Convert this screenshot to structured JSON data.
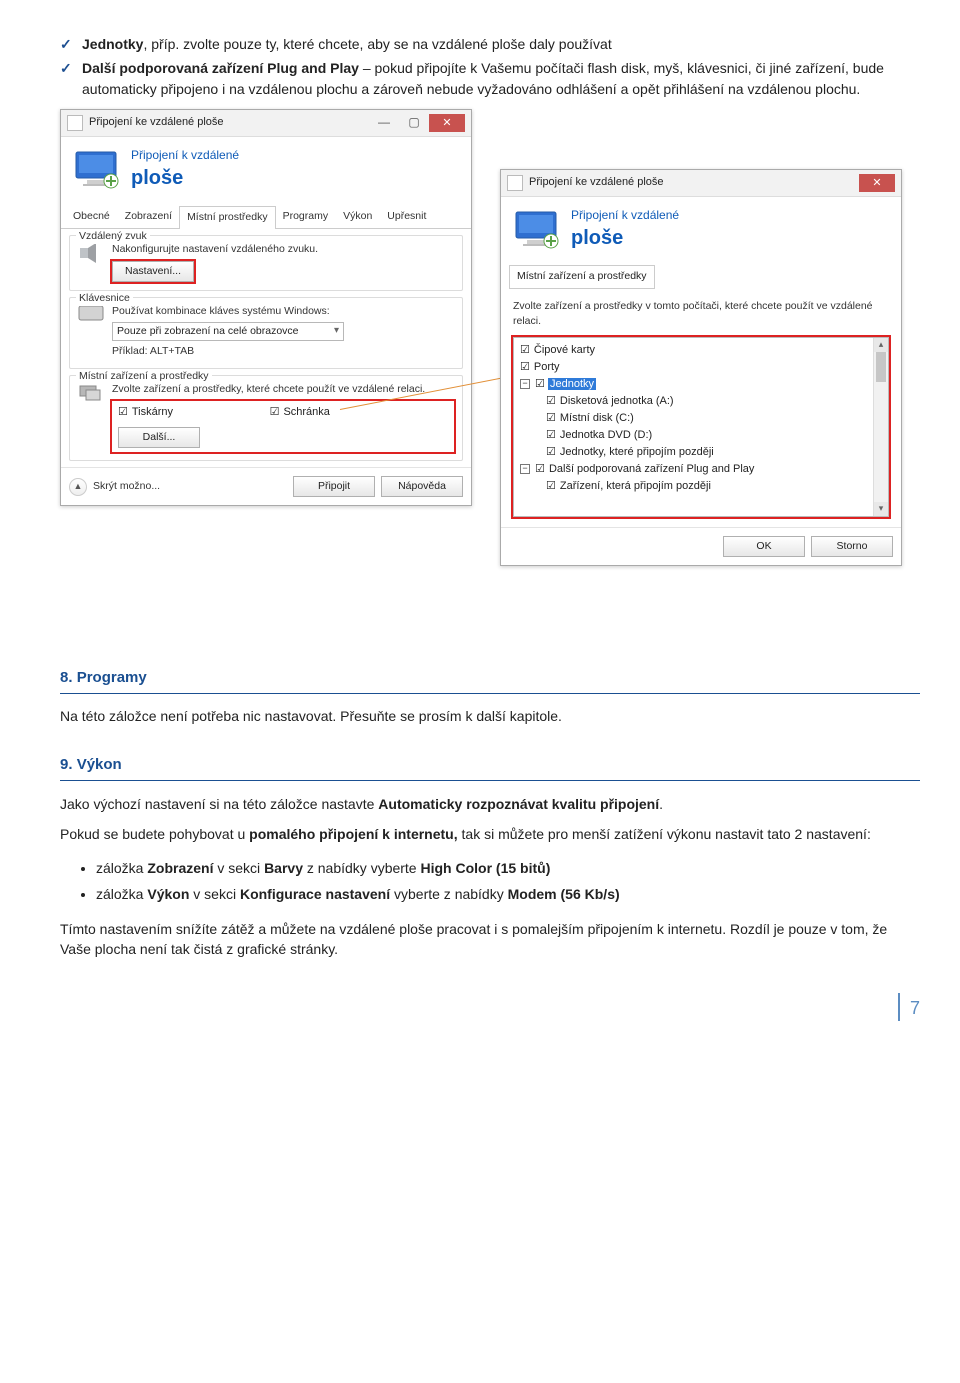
{
  "bullets": {
    "b1_label": "Jednotky",
    "b1_text": ", příp. zvolte pouze ty, které chcete, aby se na vzdálené ploše daly používat",
    "b2_label": "Další podporovaná zařízení Plug and Play",
    "b2_text": " – pokud připojíte k Vašemu počítači flash disk, myš, klávesnici, či jiné zařízení, bude automaticky připojeno i na vzdálenou plochu a zároveň nebude vyžadováno odhlášení a opět přihlášení na vzdálenou plochu."
  },
  "winL": {
    "title": "Připojení ke vzdálené ploše",
    "app_line1": "Připojení k vzdálené",
    "app_line2": "ploše",
    "tabs": [
      "Obecné",
      "Zobrazení",
      "Místní prostředky",
      "Programy",
      "Výkon",
      "Upřesnit"
    ],
    "g1": "Vzdálený zvuk",
    "g1_text": "Nakonfigurujte nastavení vzdáleného zvuku.",
    "g1_btn": "Nastavení...",
    "g2": "Klávesnice",
    "g2_text1": "Používat kombinace kláves systému Windows:",
    "g2_select": "Pouze při zobrazení na celé obrazovce",
    "g2_text2": "Příklad: ALT+TAB",
    "g3": "Místní zařízení a prostředky",
    "g3_text": "Zvolte zařízení a prostředky, které chcete použít ve vzdálené relaci.",
    "chk_print": "Tiskárny",
    "chk_clip": "Schránka",
    "g3_btn": "Další...",
    "footer_skryt": "Skrýt možno...",
    "btn_connect": "Připojit",
    "btn_help": "Nápověda"
  },
  "winR": {
    "title": "Připojení ke vzdálené ploše",
    "app_line1": "Připojení k vzdálené",
    "app_line2": "ploše",
    "tab": "Místní zařízení a prostředky",
    "desc": "Zvolte zařízení a prostředky v tomto počítači, které chcete použít ve vzdálené relaci.",
    "items": [
      "Čipové karty",
      "Porty",
      "Jednotky",
      "Disketová jednotka (A:)",
      "Místní disk (C:)",
      "Jednotka DVD (D:)",
      "Jednotky, které připojím později",
      "Další podporovaná zařízení Plug and Play",
      "Zařízení, která připojím později"
    ],
    "btn_ok": "OK",
    "btn_cancel": "Storno"
  },
  "sec8_num": "8.",
  "sec8_title": "Programy",
  "sec8_p": "Na této záložce není potřeba nic nastavovat. Přesuňte se prosím k další kapitole.",
  "sec9_num": "9.",
  "sec9_title": "Výkon",
  "sec9_p1a": "Jako výchozí nastavení si na této záložce nastavte ",
  "sec9_p1b": "Automaticky rozpoznávat kvalitu připojení",
  "sec9_p1c": ".",
  "sec9_p2a": "Pokud se budete pohybovat u ",
  "sec9_p2b": "pomalého připojení k internetu,",
  "sec9_p2c": " tak si můžete pro menší zatížení výkonu nastavit tato 2 nastavení:",
  "li1a": "záložka ",
  "li1b": "Zobrazení",
  "li1c": " v sekci ",
  "li1d": "Barvy",
  "li1e": " z nabídky vyberte ",
  "li1f": "High Color (15 bitů)",
  "li2a": "záložka ",
  "li2b": "Výkon",
  "li2c": " v sekci ",
  "li2d": "Konfigurace nastavení",
  "li2e": " vyberte z nabídky ",
  "li2f": "Modem (56 Kb/s)",
  "sec9_p3": "Tímto nastavením snížíte zátěž a můžete na vzdálené ploše pracovat i s pomalejším připojením k internetu. Rozdíl je pouze v tom, že Vaše plocha není tak čistá z grafické stránky.",
  "page": "7"
}
